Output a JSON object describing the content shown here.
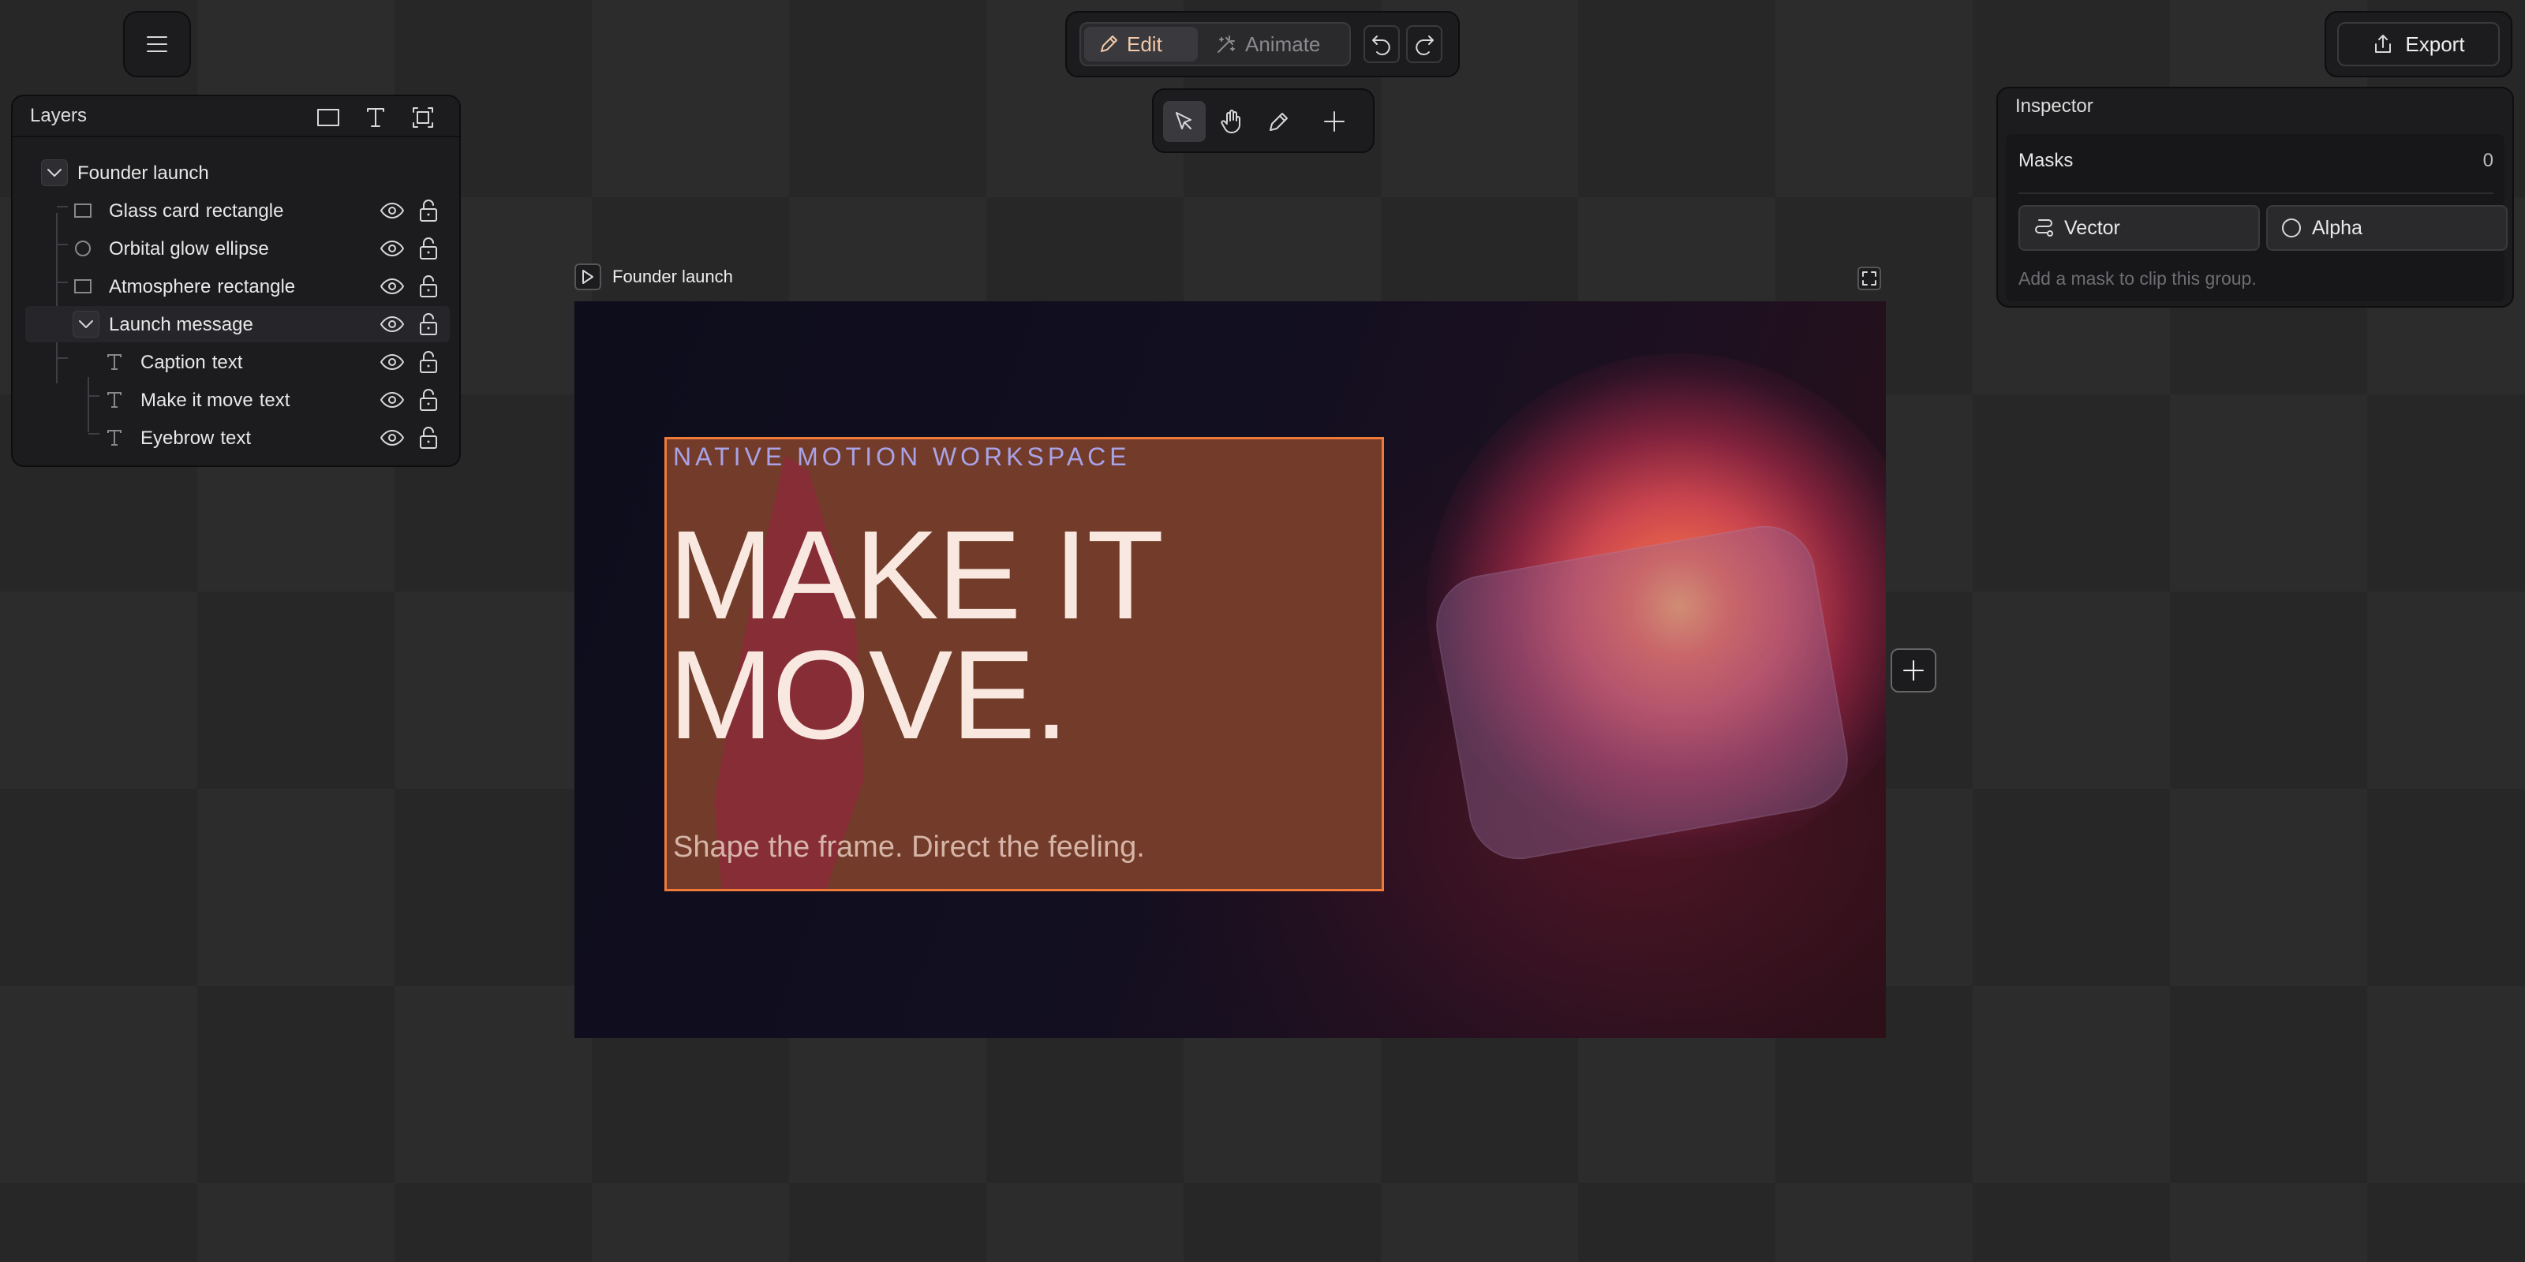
{
  "toolbar": {
    "menu_icon": "hamburger-icon",
    "modes": [
      {
        "label": "Edit",
        "icon": "pencil-icon",
        "active": true
      },
      {
        "label": "Animate",
        "icon": "magic-wand-icon",
        "active": false
      }
    ],
    "history": [
      {
        "icon": "undo-icon"
      },
      {
        "icon": "redo-icon"
      }
    ],
    "tools": [
      {
        "icon": "pointer-icon",
        "active": true
      },
      {
        "icon": "hand-icon",
        "active": false
      },
      {
        "icon": "pen-icon",
        "active": false
      },
      {
        "icon": "plus-icon",
        "active": false
      }
    ],
    "export_label": "Export"
  },
  "layers": {
    "title": "Layers",
    "head_tools": [
      "rectangle-tool-icon",
      "text-tool-icon",
      "frame-tool-icon"
    ],
    "items": [
      {
        "name": "Founder launch",
        "kind": "",
        "type": "group"
      },
      {
        "name": "Glass card",
        "kind": "rectangle",
        "type": "rectangle"
      },
      {
        "name": "Orbital glow",
        "kind": "ellipse",
        "type": "ellipse"
      },
      {
        "name": "Atmosphere",
        "kind": "rectangle",
        "type": "rectangle"
      },
      {
        "name": "Launch message",
        "kind": "",
        "type": "group",
        "selected": true
      },
      {
        "name": "Caption",
        "kind": "text",
        "type": "text"
      },
      {
        "name": "Make it move",
        "kind": "text",
        "type": "text"
      },
      {
        "name": "Eyebrow",
        "kind": "text",
        "type": "text"
      }
    ]
  },
  "inspector": {
    "title": "Inspector",
    "masks_label": "Masks",
    "masks_count": "0",
    "vector_label": "Vector",
    "alpha_label": "Alpha",
    "hint": "Add a mask to clip this group."
  },
  "canvas": {
    "frame_title": "Founder launch",
    "eyebrow": "NATIVE MOTION WORKSPACE",
    "headline": "MAKE IT\nMOVE.",
    "caption": "Shape the frame. Direct the feeling.",
    "colors": {
      "selection": "#f07a3a",
      "message_fill": "#733b29",
      "eyebrow": "#a9a2e6",
      "accent_orange": "#f5a05a"
    }
  }
}
